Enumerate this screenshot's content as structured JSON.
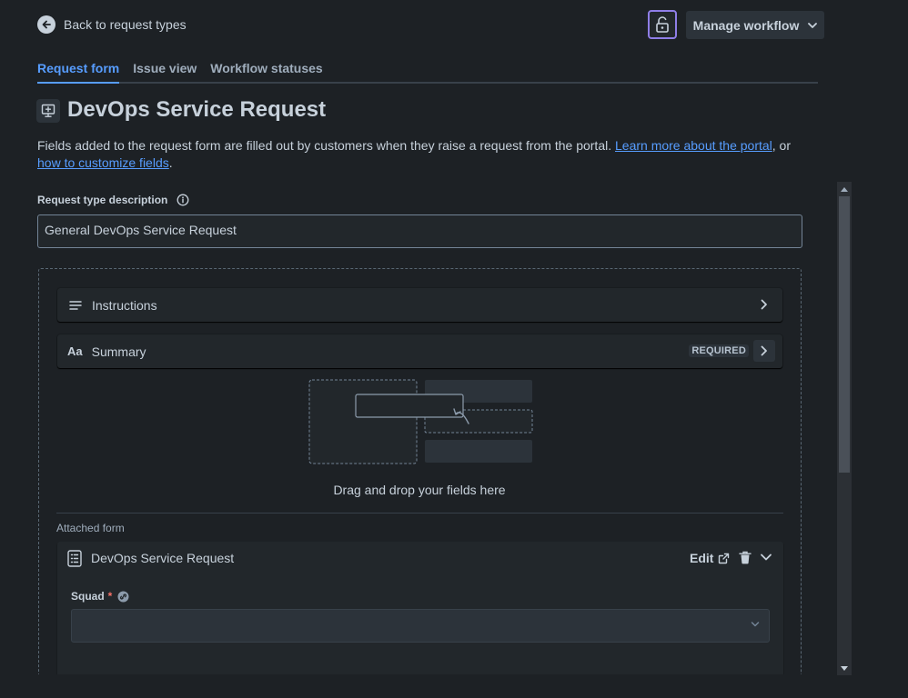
{
  "header": {
    "back_label": "Back to request types",
    "manage_workflow_label": "Manage workflow",
    "lock_icon": "unlock-icon"
  },
  "tabs": [
    {
      "label": "Request form",
      "active": true
    },
    {
      "label": "Issue view",
      "active": false
    },
    {
      "label": "Workflow statuses",
      "active": false
    }
  ],
  "page": {
    "title": "DevOps Service Request",
    "description_prefix": "Fields added to the request form are filled out by customers when they raise a request from the portal. ",
    "link_portal": "Learn more about the portal",
    "description_mid": ", or ",
    "link_customize": "how to customize fields",
    "description_suffix": "."
  },
  "request_type_description": {
    "label": "Request type description",
    "value": "General DevOps Service Request"
  },
  "fields": {
    "instructions_label": "Instructions",
    "summary_label": "Summary",
    "summary_icon_text": "Aa",
    "required_badge": "REQUIRED"
  },
  "dropzone": {
    "text": "Drag and drop your fields here"
  },
  "attached_form": {
    "section_label": "Attached form",
    "title": "DevOps Service Request",
    "edit_label": "Edit",
    "squad_label": "Squad",
    "required_mark": "*"
  },
  "colors": {
    "background": "#1d2125",
    "accent": "#579dff",
    "lock_border": "#8f7ee7",
    "required_star": "#f87168"
  }
}
